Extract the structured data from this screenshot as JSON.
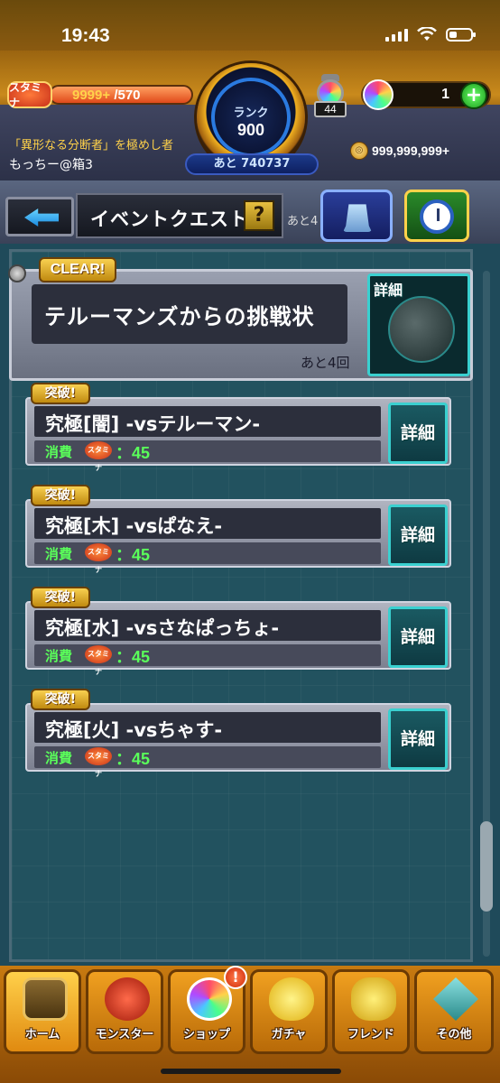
{
  "status_bar": {
    "time": "19:43"
  },
  "hud": {
    "stamina_label": "スタミナ",
    "stamina_current": "9999+",
    "stamina_max": "/570",
    "stamina_fill_fraction": 1.0,
    "rank_label": "ランク",
    "rank_value": "900",
    "rank_next": "あと 740737",
    "lantern_count": "44",
    "orb_count": "1",
    "plus_label": "+",
    "title": "「異形なる分断者」を極めし者",
    "username": "もっちー@箱3",
    "coin_amount": "999,999,999+"
  },
  "header": {
    "title": "イベントクエスト",
    "help_label": "?",
    "right_text": "あと4"
  },
  "event": {
    "badge": "CLEAR!",
    "name": "テルーマンズからの挑戦状",
    "remaining": "あと4回",
    "detail_label": "詳細"
  },
  "quests": [
    {
      "badge": "突破!",
      "title": "究極[闇] -vsテルーマン-",
      "cost_label": "消費",
      "stamina_icon": "スタミナ",
      "cost": "：45",
      "detail_label": "詳細"
    },
    {
      "badge": "突破!",
      "title": "究極[木] -vsぱなえ-",
      "cost_label": "消費",
      "stamina_icon": "スタミナ",
      "cost": "：45",
      "detail_label": "詳細"
    },
    {
      "badge": "突破!",
      "title": "究極[水] -vsさなぱっちょ-",
      "cost_label": "消費",
      "stamina_icon": "スタミナ",
      "cost": "：45",
      "detail_label": "詳細"
    },
    {
      "badge": "突破!",
      "title": "究極[火] -vsちゃす-",
      "cost_label": "消費",
      "stamina_icon": "スタミナ",
      "cost": "：45",
      "detail_label": "詳細"
    }
  ],
  "bottom_nav": [
    {
      "label": "ホーム",
      "icon": "home-icon"
    },
    {
      "label": "モンスター",
      "icon": "monster-icon"
    },
    {
      "label": "ショップ",
      "icon": "orb-shop-icon"
    },
    {
      "label": "ガチャ",
      "icon": "gacha-egg-icon"
    },
    {
      "label": "フレンド",
      "icon": "friends-icon"
    },
    {
      "label": "その他",
      "icon": "other-icon"
    }
  ],
  "shop_notice": "!",
  "colors": {
    "accent_orange": "#c87a10",
    "detail_teal": "#3ad0d0",
    "cost_green": "#5aff5a",
    "badge_gold": "#f8d050"
  }
}
